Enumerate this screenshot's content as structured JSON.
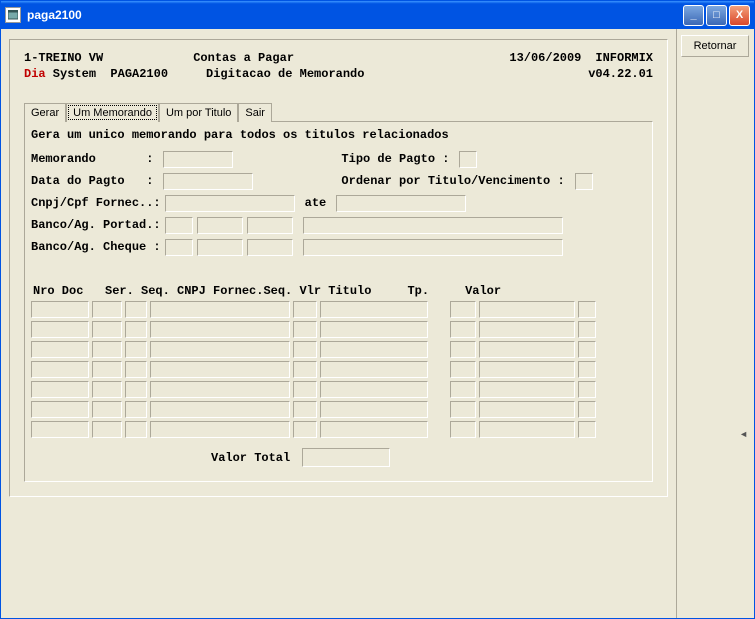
{
  "window": {
    "title": "paga2100"
  },
  "titlebar_buttons": {
    "min": "_",
    "max": "□",
    "close": "X"
  },
  "side": {
    "retornar": "Retornar"
  },
  "header": {
    "line1_left": "1-TREINO VW",
    "line1_center": "Contas a Pagar",
    "line1_date": "13/06/2009",
    "line1_right": "INFORMIX",
    "line2_dia": "Dia",
    "line2_system": " System  PAGA2100",
    "line2_center": "Digitacao de Memorando",
    "line2_right": "v04.22.01"
  },
  "tabs": [
    {
      "label": "Gerar"
    },
    {
      "label": "Um Memorando"
    },
    {
      "label": "Um por Titulo"
    },
    {
      "label": "Sair"
    }
  ],
  "active_tab": 1,
  "panel": {
    "desc": "Gera um unico memorando para todos os titulos relacionados",
    "memorando_lbl": "Memorando       :",
    "tipo_pagto_lbl": "Tipo de Pagto :",
    "data_pagto_lbl": "Data do Pagto   :",
    "ordenar_lbl": "Ordenar por Titulo/Vencimento :",
    "cnpj_lbl": "Cnpj/Cpf Fornec..:",
    "ate_lbl": "ate",
    "banco_portad_lbl": "Banco/Ag. Portad.:",
    "banco_cheque_lbl": "Banco/Ag. Cheque :"
  },
  "grid": {
    "header": "Nro Doc   Ser. Seq. CNPJ Fornec.Seq. Vlr Titulo     Tp.     Valor",
    "rows": 7,
    "total_lbl": "Valor Total"
  }
}
